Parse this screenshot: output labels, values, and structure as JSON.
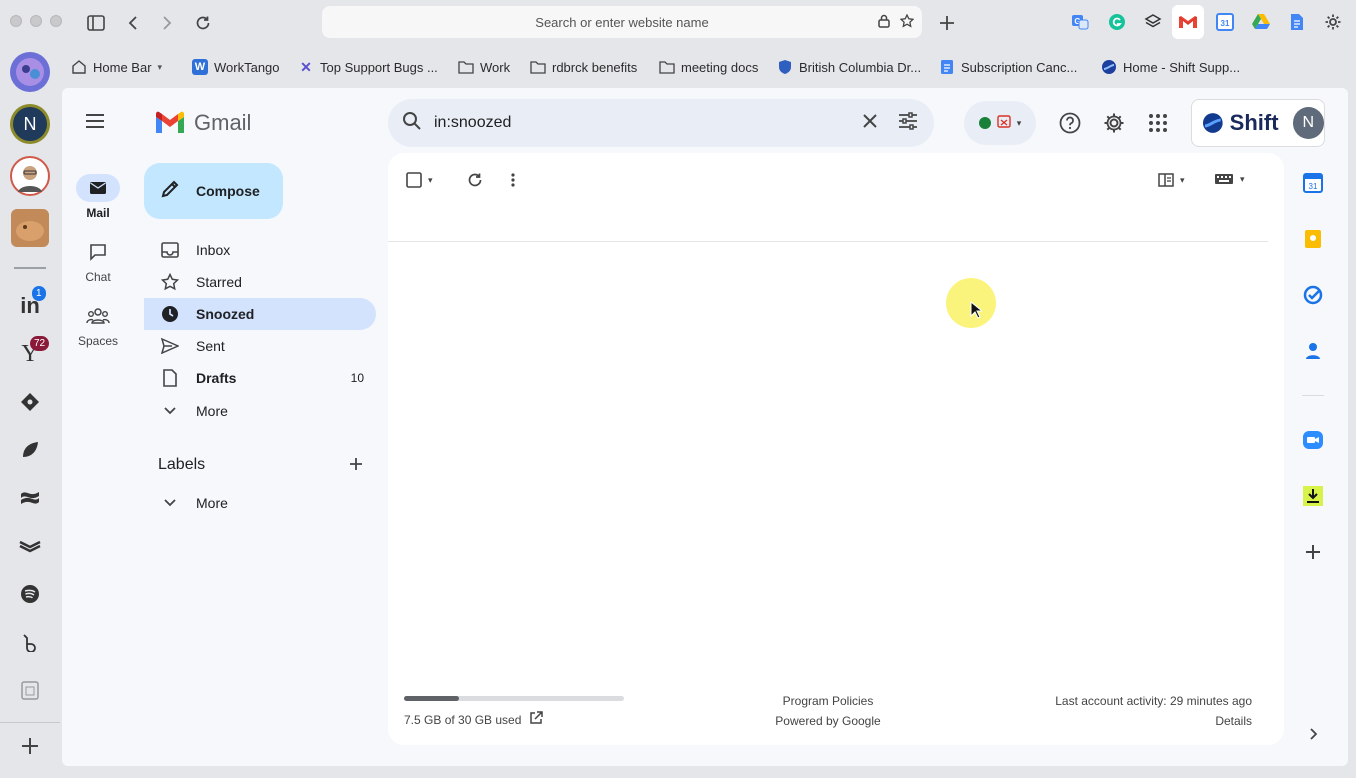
{
  "browser": {
    "url_placeholder": "Search or enter website name"
  },
  "bookmarks": [
    {
      "label": "Home Bar"
    },
    {
      "label": "WorkTango"
    },
    {
      "label": "Top Support Bugs ..."
    },
    {
      "label": "Work"
    },
    {
      "label": "rdbrck benefits"
    },
    {
      "label": "meeting docs"
    },
    {
      "label": "British Columbia Dr..."
    },
    {
      "label": "Subscription Canc..."
    },
    {
      "label": "Home - Shift Supp..."
    }
  ],
  "shift_sidebar": {
    "avatar_letter": "N",
    "linkedin_badge": "1",
    "yahoo_badge": "72"
  },
  "gmail": {
    "logo_text": "Gmail",
    "search_query": "in:snoozed",
    "shift_brand": "Shift",
    "account_letter": "N",
    "rail": [
      {
        "label": "Mail"
      },
      {
        "label": "Chat"
      },
      {
        "label": "Spaces"
      }
    ],
    "compose_label": "Compose",
    "nav": [
      {
        "label": "Inbox",
        "count": ""
      },
      {
        "label": "Starred",
        "count": ""
      },
      {
        "label": "Snoozed",
        "count": ""
      },
      {
        "label": "Sent",
        "count": ""
      },
      {
        "label": "Drafts",
        "count": "10"
      },
      {
        "label": "More",
        "count": ""
      }
    ],
    "labels_heading": "Labels",
    "labels_more": "More",
    "footer": {
      "storage_text": "7.5 GB of 30 GB used",
      "storage_fraction": 0.25,
      "policies": "Program Policies",
      "powered": "Powered by Google",
      "activity": "Last account activity: 29 minutes ago",
      "details": "Details"
    }
  },
  "colors": {
    "selected_nav": "#d3e3fd",
    "compose_bg": "#c2e7ff",
    "accent_blue": "#1a73e8"
  }
}
